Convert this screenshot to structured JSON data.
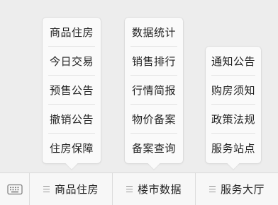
{
  "menus": [
    {
      "label": "商品住房",
      "items": [
        "商品住房",
        "今日交易",
        "预售公告",
        "撤销公告",
        "住房保障"
      ]
    },
    {
      "label": "楼市数据",
      "items": [
        "数据统计",
        "销售排行",
        "行情简报",
        "物价备案",
        "备案查询"
      ]
    },
    {
      "label": "服务大厅",
      "items": [
        "通知公告",
        "购房须知",
        "政策法规",
        "服务站点"
      ]
    }
  ],
  "icons": {
    "keyboard": "keyboard-icon",
    "menu_lines": "menu-lines-icon"
  }
}
